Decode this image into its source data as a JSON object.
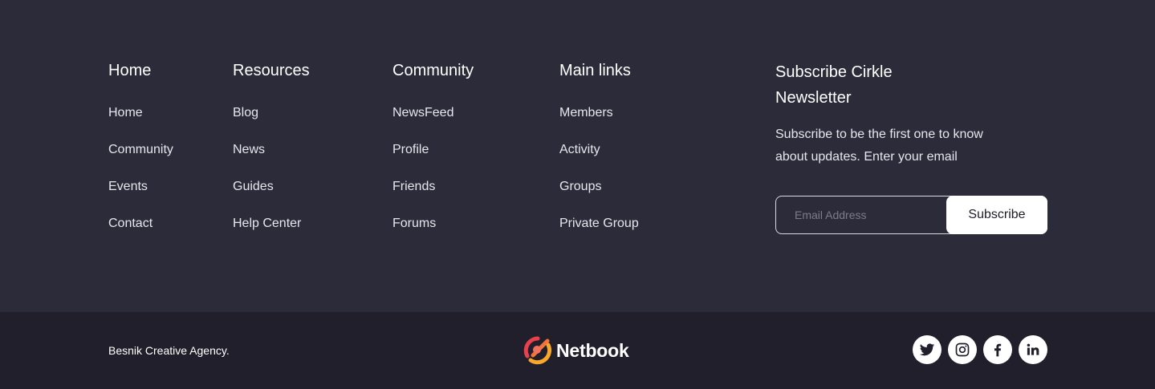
{
  "columns": {
    "home": {
      "title": "Home",
      "links": [
        "Home",
        "Community",
        "Events",
        "Contact"
      ]
    },
    "resources": {
      "title": "Resources",
      "links": [
        "Blog",
        "News",
        "Guides",
        "Help Center"
      ]
    },
    "community": {
      "title": "Community",
      "links": [
        "NewsFeed",
        "Profile",
        "Friends",
        "Forums"
      ]
    },
    "main_links": {
      "title": "Main links",
      "links": [
        "Members",
        "Activity",
        "Groups",
        "Private Group"
      ]
    }
  },
  "newsletter": {
    "title": "Subscribe Cirkle Newsletter",
    "description": "Subscribe to be the first one to know about updates. Enter your email",
    "email_placeholder": "Email Address",
    "button_label": "Subscribe"
  },
  "bottom": {
    "copyright": "Besnik Creative Agency.",
    "brand_name": "Netbook",
    "social_icons": [
      "twitter-icon",
      "instagram-icon",
      "facebook-icon",
      "linkedin-icon"
    ]
  },
  "colors": {
    "footer_top_bg": "#2c2b3a",
    "footer_bottom_bg": "#201f2b",
    "brand_red": "#e8414c",
    "brand_orange": "#f7a72a"
  }
}
